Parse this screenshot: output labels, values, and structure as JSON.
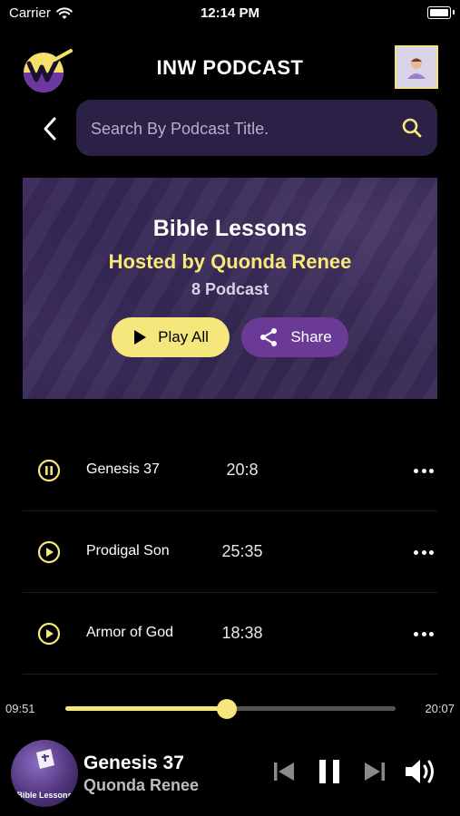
{
  "status_bar": {
    "carrier": "Carrier",
    "time": "12:14 PM"
  },
  "header": {
    "title": "INW PODCAST"
  },
  "search": {
    "placeholder": "Search By Podcast Title."
  },
  "hero": {
    "title": "Bible Lessons",
    "host": "Hosted by Quonda Renee",
    "count": "8 Podcast",
    "play_all_label": "Play All",
    "share_label": "Share"
  },
  "episodes": [
    {
      "title": "Genesis 37",
      "duration": "20:8",
      "state": "playing"
    },
    {
      "title": "Prodigal Son",
      "duration": "25:35",
      "state": "paused"
    },
    {
      "title": "Armor of God",
      "duration": "18:38",
      "state": "paused"
    }
  ],
  "player": {
    "elapsed": "09:51",
    "total": "20:07",
    "progress": 0.49,
    "now_playing_title": "Genesis 37",
    "now_playing_artist": "Quonda Renee",
    "thumb_label": "Bible Lessons"
  },
  "colors": {
    "accent": "#f6e77d",
    "purple": "#6a3a96",
    "search_bg": "#2b2045"
  }
}
